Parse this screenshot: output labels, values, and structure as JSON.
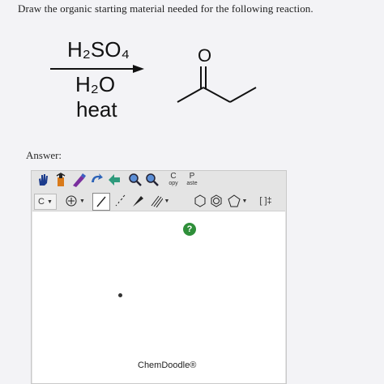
{
  "question": "Draw the organic starting material needed for the following reaction.",
  "reaction": {
    "reagent_top": "H₂SO₄",
    "reagent_mid": "H₂O",
    "reagent_bottom": "heat",
    "product_atom": "O"
  },
  "answer_label": "Answer:",
  "toolbar": {
    "copy_top": "C",
    "copy_bottom": "opy",
    "paste_top": "P",
    "paste_bottom": "aste",
    "element_label": "C",
    "charge_label": "[ ]‡"
  },
  "canvas": {
    "help_label": "?",
    "brand": "ChemDoodle®"
  }
}
